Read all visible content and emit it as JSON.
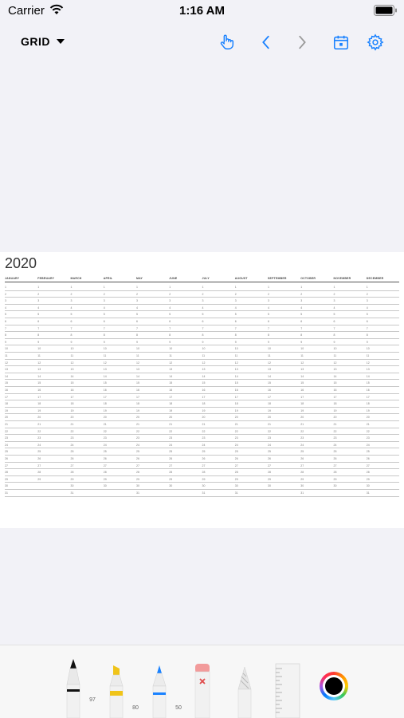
{
  "status_bar": {
    "carrier": "Carrier",
    "time": "1:16 AM"
  },
  "nav": {
    "grid_label": "GRID",
    "icons": [
      "hand-pointer-icon",
      "chevron-left-icon",
      "chevron-right-icon",
      "calendar-icon",
      "gear-icon"
    ],
    "accent_color": "#1a82ff"
  },
  "sheet": {
    "year": "2020",
    "months": [
      "JANUARY",
      "FEBRUARY",
      "MARCH",
      "APRIL",
      "MAY",
      "JUNE",
      "JULY",
      "AUGUST",
      "SEPTEMBER",
      "OCTOBER",
      "NOVEMBER",
      "DECEMBER"
    ],
    "days_in_month": [
      31,
      29,
      31,
      30,
      31,
      30,
      31,
      31,
      30,
      31,
      30,
      31
    ]
  },
  "toolbar": {
    "pen_width": "97",
    "marker_width": "80",
    "fineliner_width": "50",
    "current_color": "#000000"
  }
}
